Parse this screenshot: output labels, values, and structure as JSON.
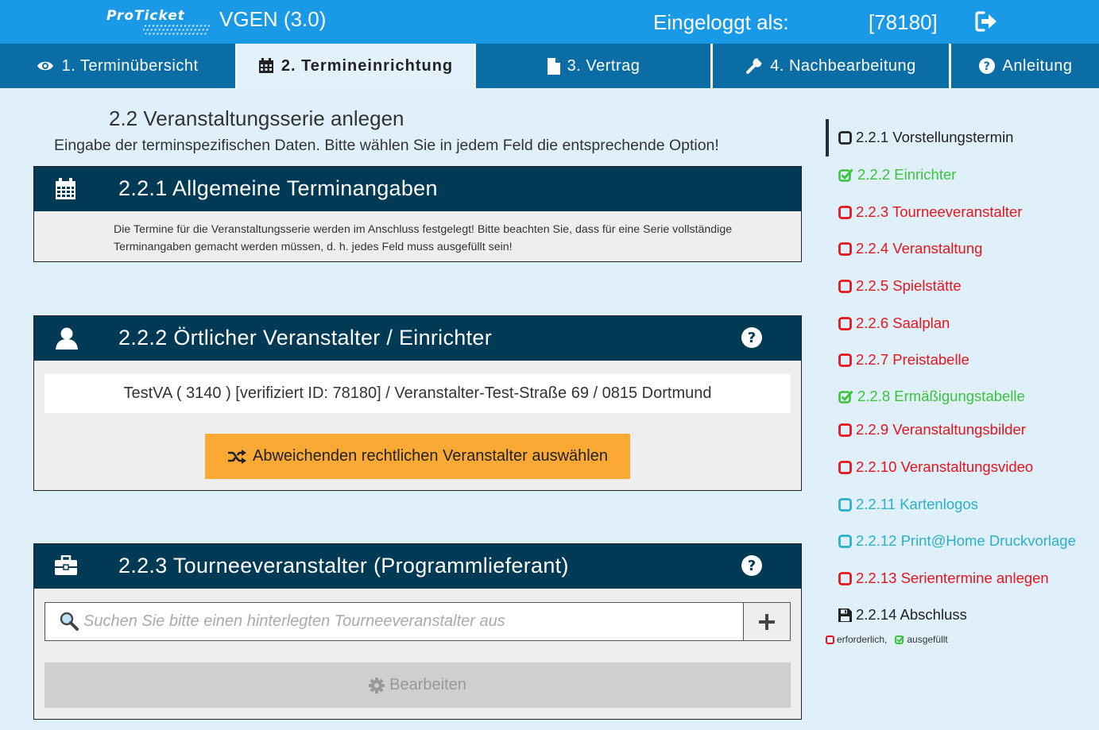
{
  "header": {
    "logo_text": "ProTicket",
    "app_title": "VGEN (3.0)",
    "login_label": "Eingeloggt als:",
    "login_id": "[78180]",
    "logout_icon": "sign-out-icon"
  },
  "tabs": [
    {
      "label": "1. Terminübersicht",
      "icon": "eye-icon",
      "active": false
    },
    {
      "label": "2. Termineinrichtung",
      "icon": "calendar-icon",
      "active": true
    },
    {
      "label": "3. Vertrag",
      "icon": "file-icon",
      "active": false
    },
    {
      "label": "4. Nachbearbeitung",
      "icon": "wrench-icon",
      "active": false
    },
    {
      "label": "Anleitung",
      "icon": "question-circle-icon",
      "active": false
    }
  ],
  "main": {
    "heading": "2.2 Veranstaltungsserie anlegen",
    "subheading": "Eingabe der terminspezifischen Daten. Bitte wählen Sie in jedem Feld die entsprechende Option!",
    "panels": {
      "general": {
        "title": "2.2.1 Allgemeine Terminangaben",
        "icon": "calendar-icon",
        "text": "Die Termine für die Veranstaltungsserie werden im Anschluss festgelegt! Bitte beachten Sie, dass für eine Serie vollständige Terminangaben gemacht werden müssen, d. h. jedes Feld muss ausgefüllt sein!"
      },
      "organizer": {
        "title": "2.2.2 Örtlicher Veranstalter / Einrichter",
        "icon": "user-icon",
        "value": "TestVA ( 3140 ) [verifiziert ID: 78180] / Veranstalter-Test-Straße 69 / 0815 Dortmund",
        "button_label": "Abweichenden rechtlichen Veranstalter auswählen",
        "button_icon": "shuffle-icon"
      },
      "tour": {
        "title": "2.2.3 Tourneeveranstalter (Programmlieferant)",
        "icon": "briefcase-icon",
        "search_placeholder": "Suchen Sie bitte einen hinterlegten Tourneeveranstalter aus",
        "edit_label": "Bearbeiten",
        "edit_icon": "gear-icon"
      }
    }
  },
  "sidebar": {
    "items": [
      {
        "label": "2.2.1 Vorstellungstermin",
        "status": "current",
        "color": "#222222"
      },
      {
        "label": "2.2.2 Einrichter",
        "status": "done",
        "color": "#3cc33c"
      },
      {
        "label": "2.2.3 Tourneeveranstalter",
        "status": "required",
        "color": "#e8141c"
      },
      {
        "label": "2.2.4 Veranstaltung",
        "status": "required",
        "color": "#e8141c"
      },
      {
        "label": "2.2.5 Spielstätte",
        "status": "required",
        "color": "#e8141c"
      },
      {
        "label": "2.2.6 Saalplan",
        "status": "required",
        "color": "#e8141c"
      },
      {
        "label": "2.2.7 Preistabelle",
        "status": "required",
        "color": "#e8141c"
      },
      {
        "label": "2.2.8 Ermäßigungstabelle",
        "status": "done",
        "color": "#3cc33c"
      },
      {
        "label": "2.2.9 Veranstaltungsbilder",
        "status": "required",
        "color": "#e8141c"
      },
      {
        "label": "2.2.10 Veranstaltungsvideo",
        "status": "required",
        "color": "#e8141c"
      },
      {
        "label": "2.2.11 Kartenlogos",
        "status": "optional",
        "color": "#2bb0c8"
      },
      {
        "label": "2.2.12 Print@Home Druckvorlage",
        "status": "optional",
        "color": "#2bb0c8"
      },
      {
        "label": "2.2.13 Serientermine anlegen",
        "status": "required",
        "color": "#e8141c"
      },
      {
        "label": "2.2.14 Abschluss",
        "status": "save",
        "color": "#222222"
      }
    ],
    "legend": {
      "required": "erforderlich,",
      "done": "ausgefüllt"
    }
  },
  "colors": {
    "topbar": "#1a9ae6",
    "tab": "#0a6da5",
    "panel_head": "#003a55",
    "orange": "#faa935",
    "background": "#dff0fb"
  }
}
